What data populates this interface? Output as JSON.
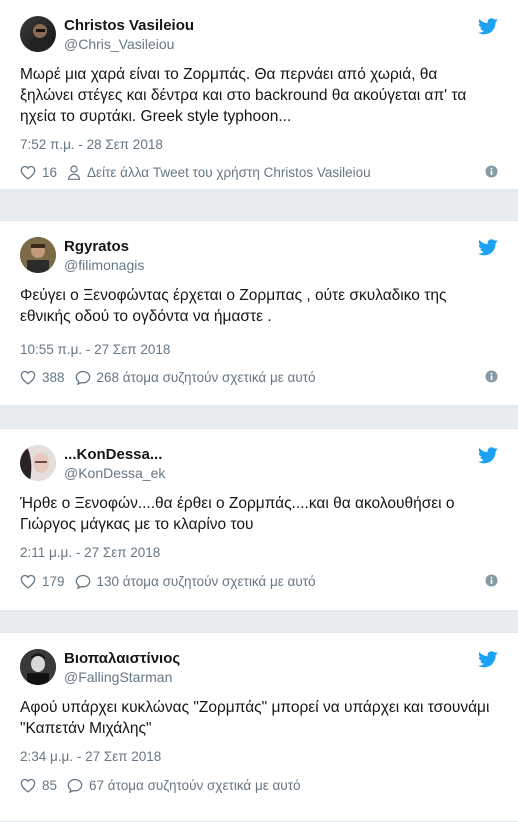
{
  "colors": {
    "twitter_blue": "#1da1f2",
    "text": "#14171a",
    "muted": "#657786",
    "background": "#e6ecf0"
  },
  "tweets": [
    {
      "name": "Christos Vasileiou",
      "handle": "@Chris_Vasileiou",
      "text": "Μωρέ μια χαρά είναι το Ζορμπάς. Θα περνάει από χωριά, θα ξηλώνει στέγες και δέντρα και στο backround θα ακούγεται απ' τα ηχεία το συρτάκι. Greek style typhoon...",
      "time": "7:52 π.μ. - 28 Σεπ 2018",
      "likes": "16",
      "second_action": "Δείτε άλλα Tweet του χρήστη Christos Vasileiou",
      "second_action_icon": "person-icon"
    },
    {
      "name": "Rgyratos",
      "handle": "@filimonagis",
      "text": "Φεύγει ο Ξενοφώντας έρχεται ο Ζορμπας , ούτε σκυλαδικο της εθνικής οδού το ογδόντα να ήμαστε .",
      "time": "10:55 π.μ. - 27 Σεπ 2018",
      "likes": "388",
      "second_action": "268 άτομα συζητούν σχετικά με αυτό",
      "second_action_icon": "comment-icon"
    },
    {
      "name": "...KonDessa...",
      "handle": "@KonDessa_ek",
      "text": "Ήρθε ο Ξενοφών....θα έρθει ο Ζορμπάς....και θα ακολουθήσει ο Γιώργος μάγκας με το κλαρίνο του",
      "time": "2:11 μ.μ. - 27 Σεπ 2018",
      "likes": "179",
      "second_action": "130 άτομα συζητούν σχετικά με αυτό",
      "second_action_icon": "comment-icon"
    },
    {
      "name": "Βιοπαλαιστίνιος",
      "handle": "@FallingStarman",
      "text": "Αφού υπάρχει κυκλώνας \"Ζορμπάς\" μπορεί να υπάρχει και τσουνάμι \"Καπετάν Μιχάλης\"",
      "time": "2:34 μ.μ. - 27 Σεπ 2018",
      "likes": "85",
      "second_action": "67 άτομα συζητούν σχετικά με αυτό",
      "second_action_icon": "comment-icon"
    }
  ]
}
